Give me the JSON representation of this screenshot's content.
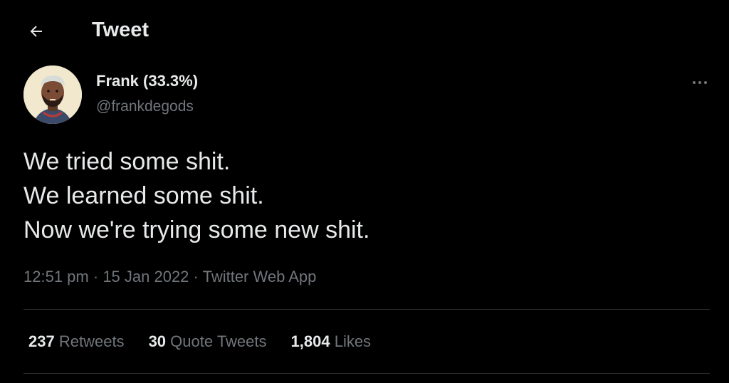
{
  "header": {
    "title": "Tweet",
    "back_icon": "arrow-left-icon"
  },
  "author": {
    "name": "Frank (33.3%)",
    "handle": "@frankdegods",
    "more_icon": "more-horizontal-icon"
  },
  "tweet": {
    "lines": [
      "We tried some shit.",
      "We learned some shit.",
      "Now we're trying some new shit."
    ],
    "time": "12:51 pm",
    "separator": "·",
    "date": "15 Jan 2022",
    "source": "Twitter Web App"
  },
  "stats": [
    {
      "count": "237",
      "label": "Retweets"
    },
    {
      "count": "30",
      "label": "Quote Tweets"
    },
    {
      "count": "1,804",
      "label": "Likes"
    }
  ],
  "colors": {
    "background": "#000000",
    "text": "#e7e9ea",
    "secondary": "#71767b",
    "divider": "#2f3336"
  }
}
